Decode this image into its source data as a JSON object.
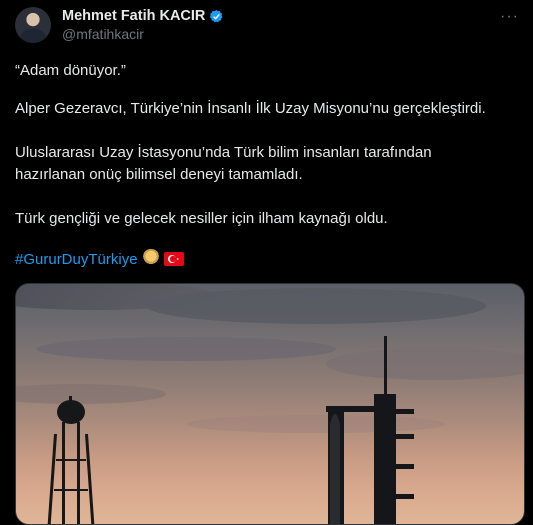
{
  "author": {
    "display_name": "Mehmet Fatih KACIR",
    "handle": "@mfatihkacir"
  },
  "post": {
    "line1": "“Adam dönüyor.”",
    "line2": "Alper Gezeravcı, Türkiye’nin İnsanlı İlk Uzay Misyonu’nu gerçekleştirdi.",
    "line3a": "Uluslararası Uzay İstasyonu’nda Türk bilim insanları tarafından",
    "line3b": "hazırlanan onüç bilimsel deneyi tamamladı.",
    "line4": "Türk gençliği ve gelecek nesiller için ilham kaynağı oldu.",
    "hashtag": "#GururDuyTürkiye"
  },
  "icons": {
    "verified": "verified-badge-icon",
    "more": "more-options-icon",
    "emoji_1": "person-emoji-icon",
    "emoji_2": "turkey-flag-icon"
  },
  "colors": {
    "background": "#000000",
    "text": "#e7e9ea",
    "muted": "#71767b",
    "link": "#1d9bf0",
    "verified": "#1d9bf0"
  }
}
